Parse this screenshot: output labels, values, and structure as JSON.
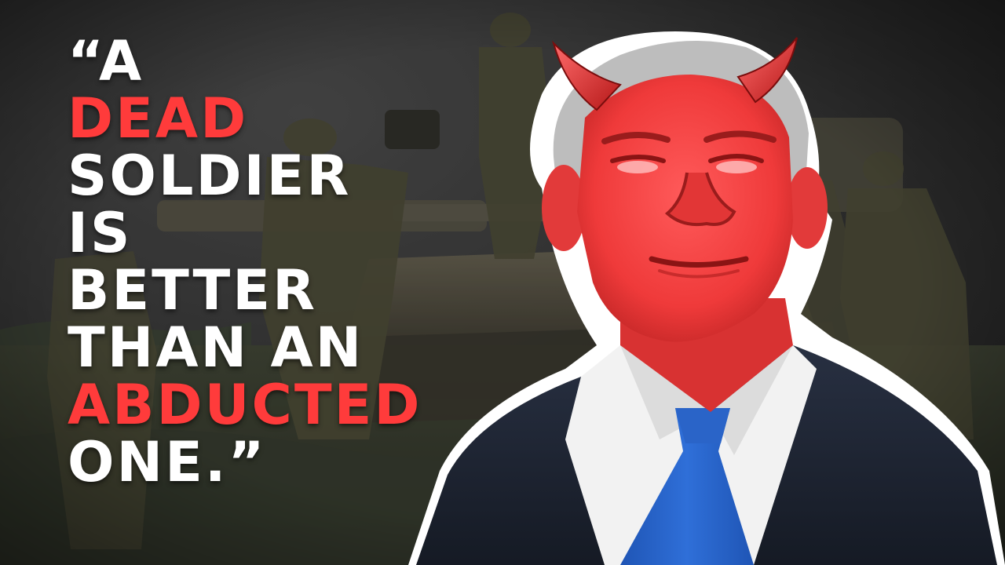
{
  "quote": {
    "lines": [
      {
        "text": "“A",
        "accent": false
      },
      {
        "text": "DEAD",
        "accent": true
      },
      {
        "text": "SOLDIER",
        "accent": false
      },
      {
        "text": "IS",
        "accent": false
      },
      {
        "text": "BETTER",
        "accent": false
      },
      {
        "text": "THAN AN",
        "accent": false
      },
      {
        "text": "ABDUCTED",
        "accent": true
      },
      {
        "text": "ONE.”",
        "accent": false
      }
    ]
  },
  "colors": {
    "text": "#ffffff",
    "accent": "#ff3b3b",
    "face_tint": "#ff4040",
    "horns": "#e02020",
    "suit": "#1c2230",
    "shirt": "#f2f2f2",
    "tie": "#2a64c8",
    "uniform": "#4b4a35",
    "background": "#2f2f2f"
  },
  "scene": {
    "background": "soldiers-on-tank",
    "foreground": "man-with-devil-horns"
  }
}
